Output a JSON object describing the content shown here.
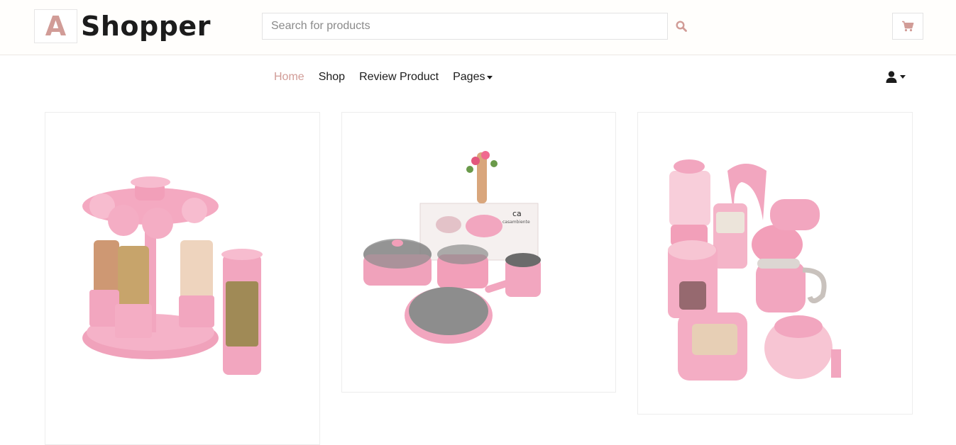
{
  "brand": {
    "letter": "A",
    "name": "Shopper"
  },
  "search": {
    "placeholder": "Search for products"
  },
  "icons": {
    "search": "search-icon",
    "cart": "shopping-cart-icon",
    "user": "user-icon"
  },
  "nav": {
    "items": [
      {
        "label": "Home",
        "active": true
      },
      {
        "label": "Shop",
        "active": false
      },
      {
        "label": "Review Product",
        "active": false
      },
      {
        "label": "Pages",
        "active": false,
        "dropdown": true
      }
    ]
  },
  "products": [
    {
      "image": "pink spice rack with jars"
    },
    {
      "image": "pink cookware set",
      "box_text": "casambiente",
      "box_logo": "ca"
    },
    {
      "image": "pink kitchen appliances set"
    }
  ],
  "colors": {
    "accent": "#d19c97",
    "text": "#1c1c1c",
    "product_pink": "#f2a3bd"
  }
}
